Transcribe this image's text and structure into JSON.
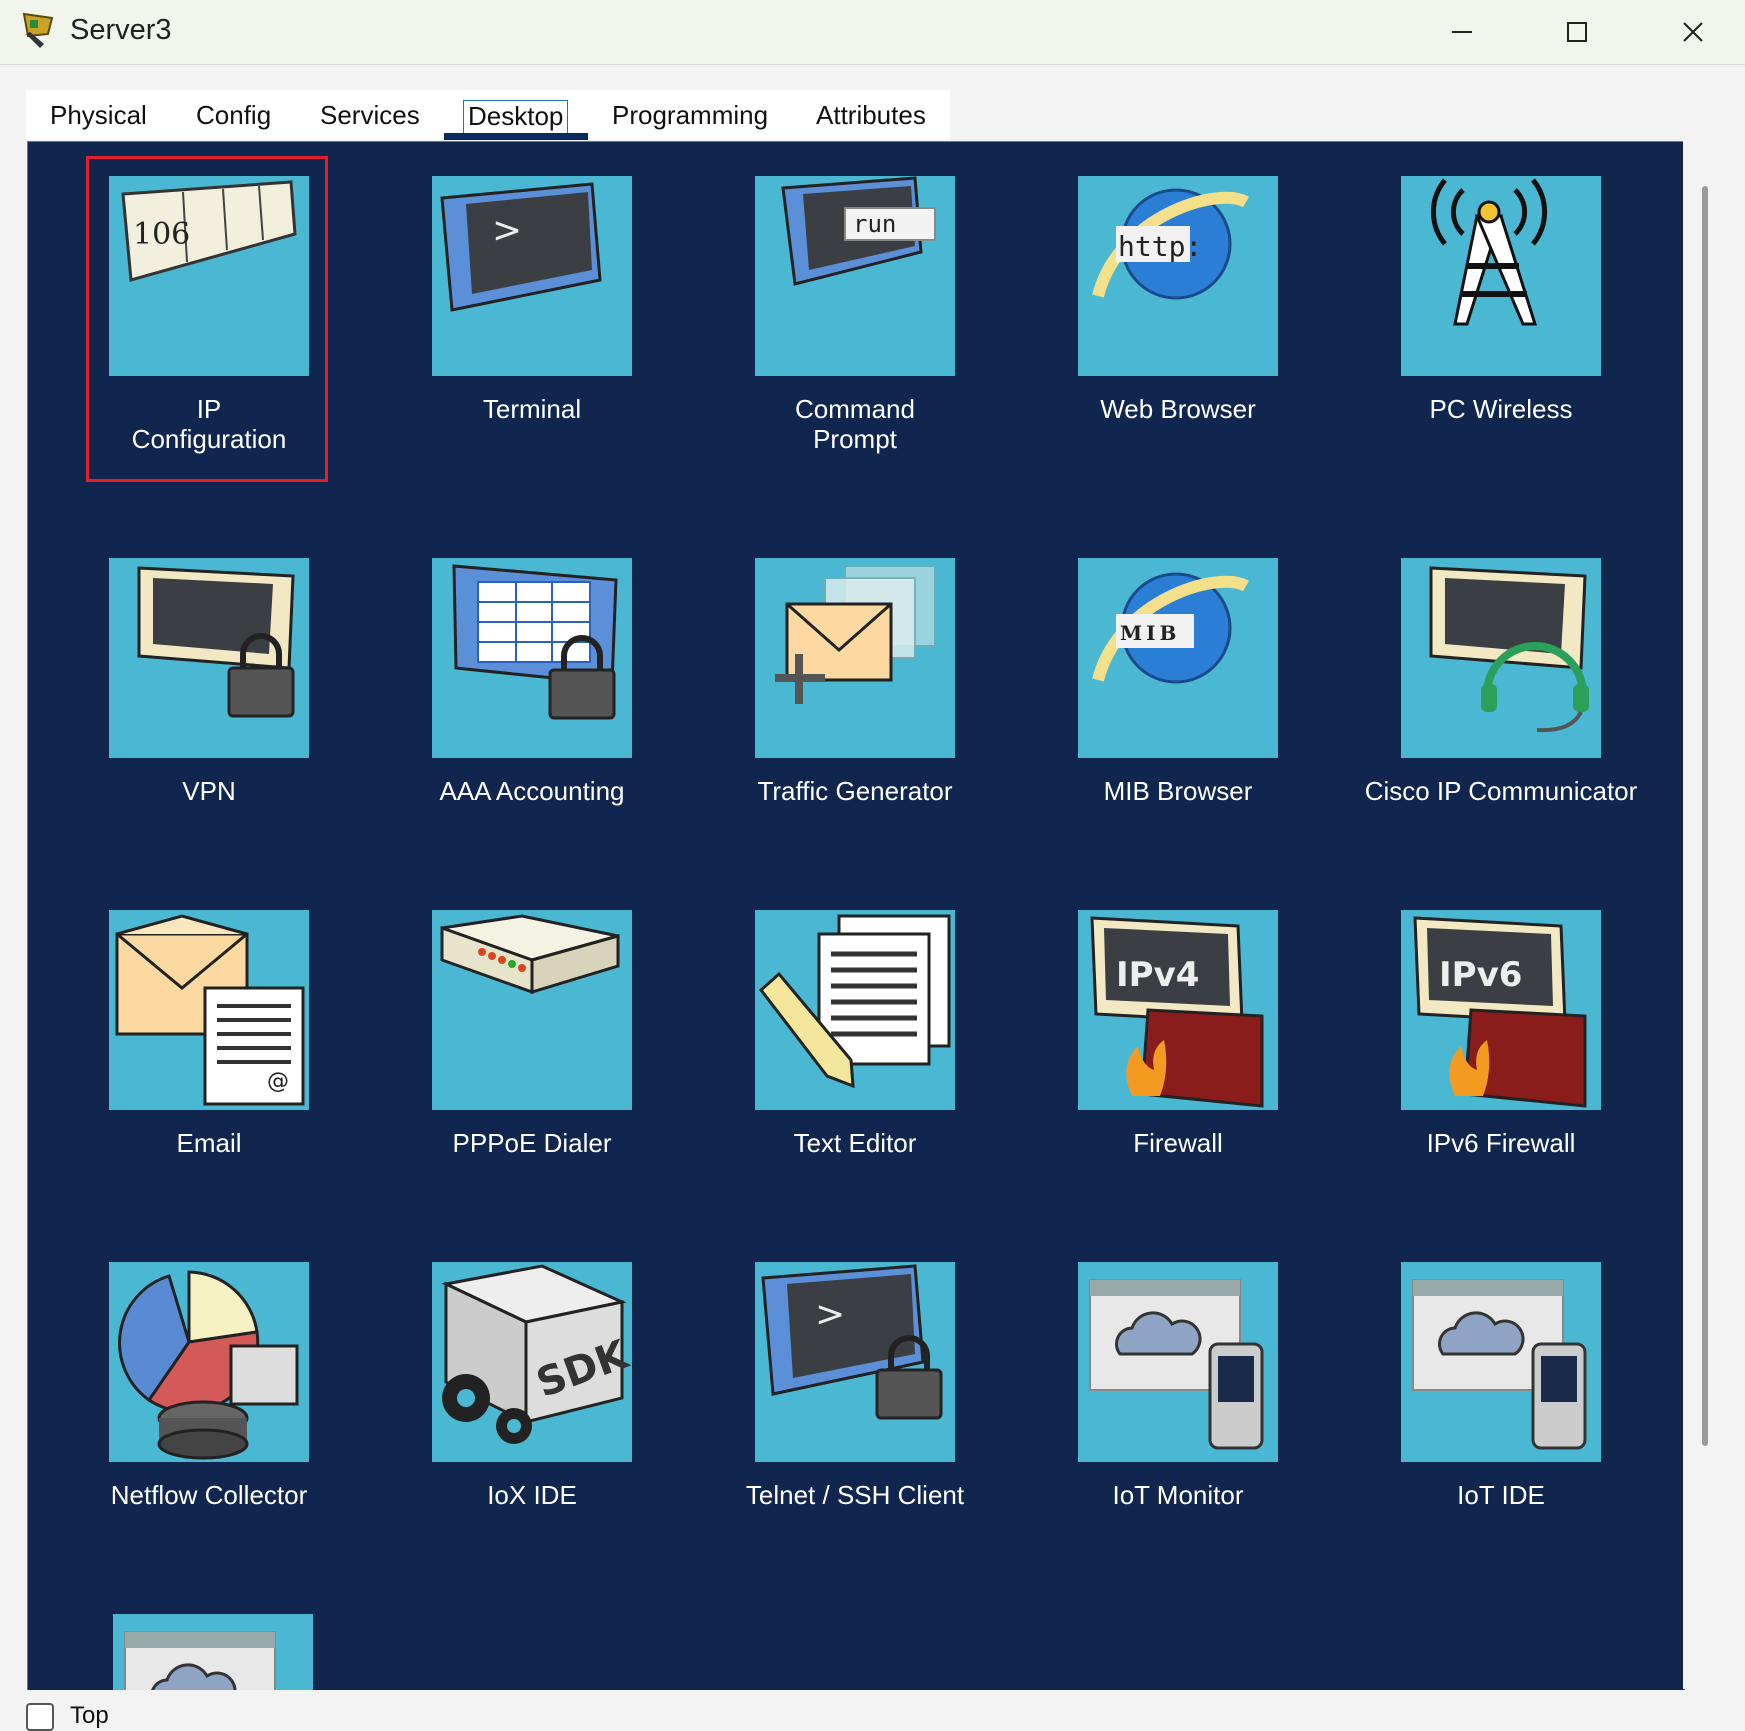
{
  "window": {
    "title": "Server3"
  },
  "tabs": [
    {
      "label": "Physical"
    },
    {
      "label": "Config"
    },
    {
      "label": "Services"
    },
    {
      "label": "Desktop"
    },
    {
      "label": "Programming"
    },
    {
      "label": "Attributes"
    }
  ],
  "active_tab": "Desktop",
  "apps": [
    {
      "label": "IP\nConfiguration",
      "icon": "ip-config-icon",
      "tile_text": "106"
    },
    {
      "label": "Terminal",
      "icon": "terminal-icon",
      "tile_text": ">"
    },
    {
      "label": "Command\nPrompt",
      "icon": "command-prompt-icon",
      "tile_text": "run"
    },
    {
      "label": "Web Browser",
      "icon": "web-browser-icon",
      "tile_text": "http:"
    },
    {
      "label": "PC Wireless",
      "icon": "wireless-tower-icon"
    },
    {
      "label": "VPN",
      "icon": "vpn-monitor-lock-icon"
    },
    {
      "label": "AAA Accounting",
      "icon": "aaa-accounting-icon"
    },
    {
      "label": "Traffic Generator",
      "icon": "traffic-generator-icon"
    },
    {
      "label": "MIB Browser",
      "icon": "mib-browser-icon",
      "tile_text": "MIB"
    },
    {
      "label": "Cisco IP Communicator",
      "icon": "ip-communicator-icon"
    },
    {
      "label": "Email",
      "icon": "email-icon"
    },
    {
      "label": "PPPoE Dialer",
      "icon": "pppoe-dialer-icon"
    },
    {
      "label": "Text Editor",
      "icon": "text-editor-icon"
    },
    {
      "label": "Firewall",
      "icon": "firewall-icon",
      "tile_text": "IPv4"
    },
    {
      "label": "IPv6 Firewall",
      "icon": "ipv6-firewall-icon",
      "tile_text": "IPv6"
    },
    {
      "label": "Netflow Collector",
      "icon": "netflow-collector-icon"
    },
    {
      "label": "IoX IDE",
      "icon": "iox-ide-icon",
      "tile_text": "SDK"
    },
    {
      "label": "Telnet / SSH Client",
      "icon": "telnet-ssh-icon",
      "tile_text": ">"
    },
    {
      "label": "IoT Monitor",
      "icon": "iot-monitor-icon"
    },
    {
      "label": "IoT IDE",
      "icon": "iot-ide-icon"
    },
    {
      "label": "",
      "icon": "partial-app-icon"
    }
  ],
  "bottom": {
    "checkbox_label": "Top"
  }
}
